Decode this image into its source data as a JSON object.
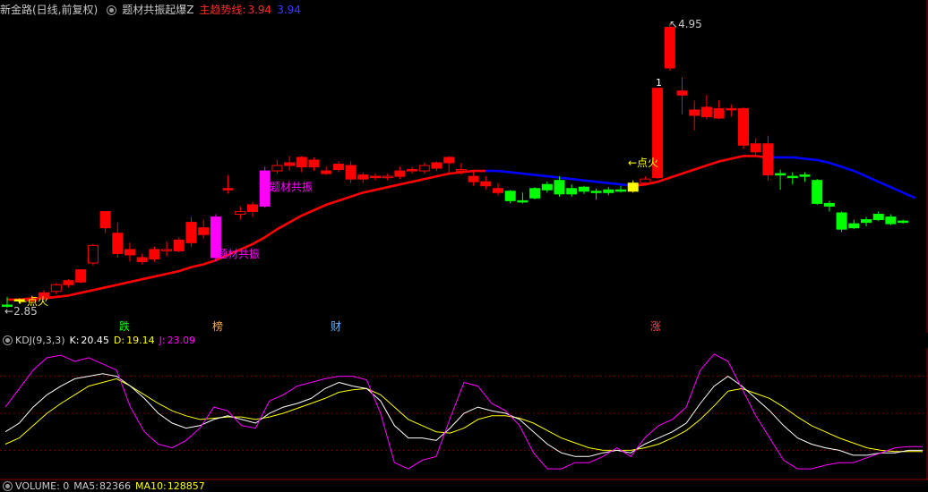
{
  "header": {
    "stock_period": "新金路(日线,前复权)",
    "indicator_name": "题材共振起爆Z",
    "trend_label": "主趋势线:",
    "trend_value_red": "3.94",
    "trend_value_blue": "3.94"
  },
  "price_chart": {
    "max_label": "4.95",
    "min_label": "2.85",
    "ignite_label": "←点火",
    "resonance_label": "题材共振",
    "day_tags": [
      "跌",
      "榜",
      "财",
      "涨"
    ],
    "marker_1": "1"
  },
  "kdj_header": {
    "name": "KDJ(9,3,3)",
    "k_label": "K:",
    "k_value": "20.45",
    "d_label": "D:",
    "d_value": "19.14",
    "j_label": "J:",
    "j_value": "23.09"
  },
  "volume_header": {
    "name": "VOLUME: 0",
    "ma5_label": "MA5:",
    "ma5_value": "82366",
    "ma10_label": "MA10:",
    "ma10_value": "128857"
  },
  "colors": {
    "up": "#ff0000",
    "down": "#00ff00",
    "resonance": "#ff00ff",
    "ignite": "#ffff00",
    "trend_up": "#ff0000",
    "trend_down": "#0000ff",
    "k_line": "#ffffff",
    "d_line": "#ffff00",
    "j_line": "#ff00ff"
  },
  "chart_data": {
    "type": "candlestick",
    "price_range": [
      2.85,
      4.95
    ],
    "candles": [
      {
        "o": 2.87,
        "h": 2.93,
        "l": 2.85,
        "c": 2.86,
        "color": "green"
      },
      {
        "o": 2.9,
        "h": 2.92,
        "l": 2.88,
        "c": 2.91,
        "color": "yellow"
      },
      {
        "o": 2.9,
        "h": 2.94,
        "l": 2.87,
        "c": 2.92,
        "color": "red"
      },
      {
        "o": 2.93,
        "h": 2.98,
        "l": 2.91,
        "c": 2.96,
        "color": "red"
      },
      {
        "o": 2.97,
        "h": 3.03,
        "l": 2.95,
        "c": 3.02,
        "color": "red"
      },
      {
        "o": 3.02,
        "h": 3.06,
        "l": 3.0,
        "c": 3.05,
        "color": "red"
      },
      {
        "o": 3.04,
        "h": 3.13,
        "l": 3.03,
        "c": 3.13,
        "color": "red"
      },
      {
        "o": 3.18,
        "h": 3.32,
        "l": 3.16,
        "c": 3.31,
        "color": "red"
      },
      {
        "o": 3.44,
        "h": 3.56,
        "l": 3.4,
        "c": 3.56,
        "color": "red"
      },
      {
        "o": 3.4,
        "h": 3.48,
        "l": 3.22,
        "c": 3.25,
        "color": "red"
      },
      {
        "o": 3.28,
        "h": 3.33,
        "l": 3.19,
        "c": 3.24,
        "color": "red"
      },
      {
        "o": 3.22,
        "h": 3.25,
        "l": 3.17,
        "c": 3.19,
        "color": "red"
      },
      {
        "o": 3.21,
        "h": 3.3,
        "l": 3.19,
        "c": 3.28,
        "color": "red"
      },
      {
        "o": 3.27,
        "h": 3.34,
        "l": 3.23,
        "c": 3.28,
        "color": "red"
      },
      {
        "o": 3.27,
        "h": 3.37,
        "l": 3.26,
        "c": 3.35,
        "color": "red"
      },
      {
        "o": 3.33,
        "h": 3.52,
        "l": 3.3,
        "c": 3.48,
        "color": "red"
      },
      {
        "o": 3.44,
        "h": 3.5,
        "l": 3.36,
        "c": 3.39,
        "color": "red"
      },
      {
        "o": 3.22,
        "h": 3.54,
        "l": 3.19,
        "c": 3.52,
        "color": "magenta"
      },
      {
        "o": 3.72,
        "h": 3.83,
        "l": 3.69,
        "c": 3.73,
        "color": "red"
      },
      {
        "o": 3.54,
        "h": 3.6,
        "l": 3.5,
        "c": 3.56,
        "color": "red"
      },
      {
        "o": 3.56,
        "h": 3.63,
        "l": 3.52,
        "c": 3.61,
        "color": "red"
      },
      {
        "o": 3.6,
        "h": 3.89,
        "l": 3.59,
        "c": 3.86,
        "color": "magenta"
      },
      {
        "o": 3.86,
        "h": 3.94,
        "l": 3.84,
        "c": 3.9,
        "color": "red"
      },
      {
        "o": 3.92,
        "h": 3.97,
        "l": 3.86,
        "c": 3.9,
        "color": "red"
      },
      {
        "o": 3.89,
        "h": 3.97,
        "l": 3.85,
        "c": 3.96,
        "color": "red"
      },
      {
        "o": 3.94,
        "h": 3.96,
        "l": 3.86,
        "c": 3.89,
        "color": "red"
      },
      {
        "o": 3.86,
        "h": 3.89,
        "l": 3.83,
        "c": 3.84,
        "color": "red"
      },
      {
        "o": 3.87,
        "h": 3.93,
        "l": 3.85,
        "c": 3.91,
        "color": "red"
      },
      {
        "o": 3.9,
        "h": 3.93,
        "l": 3.77,
        "c": 3.8,
        "color": "red"
      },
      {
        "o": 3.8,
        "h": 3.85,
        "l": 3.77,
        "c": 3.83,
        "color": "red"
      },
      {
        "o": 3.82,
        "h": 3.84,
        "l": 3.79,
        "c": 3.82,
        "color": "red"
      },
      {
        "o": 3.81,
        "h": 3.84,
        "l": 3.79,
        "c": 3.82,
        "color": "red"
      },
      {
        "o": 3.82,
        "h": 3.89,
        "l": 3.8,
        "c": 3.86,
        "color": "red"
      },
      {
        "o": 3.87,
        "h": 3.89,
        "l": 3.84,
        "c": 3.86,
        "color": "red"
      },
      {
        "o": 3.86,
        "h": 3.92,
        "l": 3.84,
        "c": 3.9,
        "color": "red"
      },
      {
        "o": 3.88,
        "h": 3.93,
        "l": 3.86,
        "c": 3.92,
        "color": "red"
      },
      {
        "o": 3.92,
        "h": 3.97,
        "l": 3.84,
        "c": 3.96,
        "color": "red"
      },
      {
        "o": 3.86,
        "h": 3.92,
        "l": 3.83,
        "c": 3.87,
        "color": "red"
      },
      {
        "o": 3.82,
        "h": 3.86,
        "l": 3.75,
        "c": 3.78,
        "color": "red"
      },
      {
        "o": 3.78,
        "h": 3.82,
        "l": 3.72,
        "c": 3.75,
        "color": "red"
      },
      {
        "o": 3.73,
        "h": 3.77,
        "l": 3.68,
        "c": 3.7,
        "color": "red"
      },
      {
        "o": 3.71,
        "h": 3.72,
        "l": 3.62,
        "c": 3.64,
        "color": "green"
      },
      {
        "o": 3.64,
        "h": 3.7,
        "l": 3.62,
        "c": 3.64,
        "color": "green"
      },
      {
        "o": 3.66,
        "h": 3.74,
        "l": 3.65,
        "c": 3.73,
        "color": "green"
      },
      {
        "o": 3.72,
        "h": 3.78,
        "l": 3.7,
        "c": 3.76,
        "color": "green"
      },
      {
        "o": 3.79,
        "h": 3.82,
        "l": 3.67,
        "c": 3.69,
        "color": "green"
      },
      {
        "o": 3.69,
        "h": 3.76,
        "l": 3.67,
        "c": 3.73,
        "color": "green"
      },
      {
        "o": 3.74,
        "h": 3.75,
        "l": 3.69,
        "c": 3.71,
        "color": "green"
      },
      {
        "o": 3.71,
        "h": 3.73,
        "l": 3.65,
        "c": 3.7,
        "color": "green"
      },
      {
        "o": 3.7,
        "h": 3.74,
        "l": 3.68,
        "c": 3.72,
        "color": "green"
      },
      {
        "o": 3.72,
        "h": 3.75,
        "l": 3.7,
        "c": 3.72,
        "color": "green"
      },
      {
        "o": 3.71,
        "h": 3.79,
        "l": 3.7,
        "c": 3.77,
        "color": "yellow"
      },
      {
        "o": 3.77,
        "h": 3.82,
        "l": 3.76,
        "c": 3.8,
        "color": "red"
      },
      {
        "o": 3.81,
        "h": 4.47,
        "l": 3.8,
        "c": 4.47,
        "color": "red"
      },
      {
        "o": 4.62,
        "h": 4.95,
        "l": 4.6,
        "c": 4.92,
        "color": "red"
      },
      {
        "o": 4.45,
        "h": 4.55,
        "l": 4.28,
        "c": 4.42,
        "color": "red"
      },
      {
        "o": 4.31,
        "h": 4.38,
        "l": 4.16,
        "c": 4.27,
        "color": "red"
      },
      {
        "o": 4.33,
        "h": 4.42,
        "l": 4.24,
        "c": 4.26,
        "color": "red"
      },
      {
        "o": 4.32,
        "h": 4.38,
        "l": 4.24,
        "c": 4.25,
        "color": "red"
      },
      {
        "o": 4.32,
        "h": 4.35,
        "l": 4.26,
        "c": 4.31,
        "color": "red"
      },
      {
        "o": 4.32,
        "h": 4.33,
        "l": 4.02,
        "c": 4.05,
        "color": "red"
      },
      {
        "o": 4.06,
        "h": 4.1,
        "l": 3.98,
        "c": 4.0,
        "color": "red"
      },
      {
        "o": 4.06,
        "h": 4.12,
        "l": 3.79,
        "c": 3.83,
        "color": "red"
      },
      {
        "o": 3.84,
        "h": 3.87,
        "l": 3.72,
        "c": 3.83,
        "color": "green"
      },
      {
        "o": 3.82,
        "h": 3.85,
        "l": 3.76,
        "c": 3.82,
        "color": "green"
      },
      {
        "o": 3.82,
        "h": 3.85,
        "l": 3.78,
        "c": 3.83,
        "color": "green"
      },
      {
        "o": 3.79,
        "h": 3.8,
        "l": 3.61,
        "c": 3.62,
        "color": "green"
      },
      {
        "o": 3.62,
        "h": 3.64,
        "l": 3.56,
        "c": 3.6,
        "color": "green"
      },
      {
        "o": 3.55,
        "h": 3.56,
        "l": 3.41,
        "c": 3.43,
        "color": "green"
      },
      {
        "o": 3.44,
        "h": 3.5,
        "l": 3.43,
        "c": 3.47,
        "color": "green"
      },
      {
        "o": 3.48,
        "h": 3.52,
        "l": 3.45,
        "c": 3.5,
        "color": "green"
      },
      {
        "o": 3.54,
        "h": 3.56,
        "l": 3.49,
        "c": 3.5,
        "color": "green"
      },
      {
        "o": 3.52,
        "h": 3.54,
        "l": 3.46,
        "c": 3.47,
        "color": "green"
      },
      {
        "o": 3.49,
        "h": 3.5,
        "l": 3.47,
        "c": 3.48,
        "color": "green"
      }
    ],
    "trend_line": [
      2.91,
      2.91,
      2.92,
      2.92,
      2.93,
      2.94,
      2.96,
      2.98,
      3.0,
      3.02,
      3.04,
      3.06,
      3.08,
      3.1,
      3.12,
      3.15,
      3.17,
      3.2,
      3.24,
      3.28,
      3.32,
      3.37,
      3.43,
      3.48,
      3.53,
      3.57,
      3.61,
      3.64,
      3.67,
      3.7,
      3.72,
      3.74,
      3.76,
      3.78,
      3.8,
      3.82,
      3.84,
      3.85,
      3.86,
      3.86,
      3.86,
      3.85,
      3.84,
      3.83,
      3.82,
      3.81,
      3.8,
      3.79,
      3.78,
      3.77,
      3.76,
      3.75,
      3.76,
      3.78,
      3.81,
      3.84,
      3.87,
      3.9,
      3.93,
      3.95,
      3.97,
      3.97,
      3.96,
      3.96,
      3.96,
      3.95,
      3.94,
      3.92,
      3.89,
      3.86,
      3.82,
      3.78,
      3.74,
      3.7,
      3.66
    ],
    "kdj": {
      "range": [
        0,
        100
      ],
      "K": [
        35,
        42,
        55,
        65,
        72,
        78,
        80,
        82,
        80,
        72,
        62,
        50,
        42,
        38,
        40,
        45,
        48,
        45,
        42,
        50,
        55,
        58,
        62,
        70,
        75,
        72,
        70,
        60,
        40,
        30,
        30,
        28,
        38,
        50,
        55,
        52,
        50,
        45,
        35,
        25,
        18,
        15,
        15,
        18,
        20,
        18,
        25,
        30,
        35,
        42,
        58,
        72,
        80,
        72,
        62,
        52,
        40,
        30,
        25,
        22,
        20,
        16,
        16,
        18,
        18,
        20,
        20
      ],
      "D": [
        25,
        30,
        40,
        50,
        58,
        65,
        72,
        75,
        78,
        72,
        65,
        58,
        52,
        48,
        45,
        46,
        47,
        47,
        45,
        47,
        50,
        54,
        58,
        62,
        67,
        69,
        70,
        65,
        55,
        45,
        40,
        35,
        34,
        38,
        45,
        48,
        48,
        46,
        42,
        36,
        30,
        26,
        22,
        20,
        20,
        20,
        22,
        25,
        30,
        36,
        45,
        56,
        68,
        70,
        66,
        62,
        55,
        47,
        40,
        35,
        30,
        26,
        22,
        20,
        19,
        19,
        19
      ],
      "J": [
        55,
        70,
        85,
        95,
        97,
        92,
        95,
        90,
        85,
        55,
        35,
        25,
        22,
        28,
        38,
        55,
        52,
        40,
        38,
        60,
        65,
        72,
        75,
        78,
        80,
        80,
        77,
        50,
        10,
        5,
        12,
        15,
        46,
        75,
        72,
        58,
        52,
        40,
        18,
        5,
        5,
        10,
        10,
        15,
        22,
        15,
        30,
        40,
        45,
        55,
        85,
        98,
        92,
        70,
        48,
        30,
        12,
        5,
        5,
        8,
        10,
        10,
        14,
        18,
        22,
        23,
        23
      ]
    }
  }
}
